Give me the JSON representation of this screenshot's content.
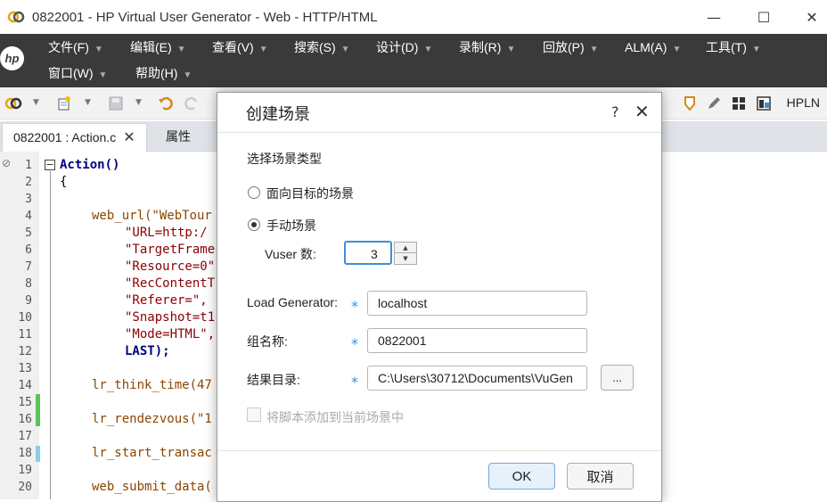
{
  "window": {
    "title": "0822001 - HP Virtual User Generator - Web - HTTP/HTML",
    "minimize": "—",
    "maximize": "☐",
    "close": "✕"
  },
  "menu": {
    "row1": [
      "文件(F)",
      "编辑(E)",
      "查看(V)",
      "搜索(S)",
      "设计(D)",
      "录制(R)",
      "回放(P)",
      "ALM(A)",
      "工具(T)"
    ],
    "row2": [
      "窗口(W)",
      "帮助(H)"
    ],
    "logo": "hp"
  },
  "toolbar": {
    "right_label": "HPLN"
  },
  "tabs": {
    "active": "0822001 : Action.c",
    "close": "✕",
    "other": "属性"
  },
  "editor": {
    "lines": [
      {
        "n": "1",
        "text": "Action()"
      },
      {
        "n": "2",
        "text": "{"
      },
      {
        "n": "3",
        "text": ""
      },
      {
        "n": "4",
        "text": "web_url(\"WebTour"
      },
      {
        "n": "5",
        "text": "\"URL=http:/"
      },
      {
        "n": "6",
        "text": "\"TargetFrame"
      },
      {
        "n": "7",
        "text": "\"Resource=0\""
      },
      {
        "n": "8",
        "text": "\"RecContentT"
      },
      {
        "n": "9",
        "text": "\"Referer=\","
      },
      {
        "n": "10",
        "text": "\"Snapshot=t1"
      },
      {
        "n": "11",
        "text": "\"Mode=HTML\","
      },
      {
        "n": "12",
        "text": "LAST);"
      },
      {
        "n": "13",
        "text": ""
      },
      {
        "n": "14",
        "text": "lr_think_time(47"
      },
      {
        "n": "15",
        "text": ""
      },
      {
        "n": "16",
        "text": "lr_rendezvous(\"1"
      },
      {
        "n": "17",
        "text": ""
      },
      {
        "n": "18",
        "text": "lr_start_transac"
      },
      {
        "n": "19",
        "text": ""
      },
      {
        "n": "20",
        "text": "web_submit_data("
      }
    ]
  },
  "dialog": {
    "title": "创建场景",
    "help": "?",
    "close": "✕",
    "section_label": "选择场景类型",
    "radio_goal": "面向目标的场景",
    "radio_manual": "手动场景",
    "vuser_label": "Vuser 数:",
    "vuser_value": "3",
    "spin_up": "▲",
    "spin_down": "▼",
    "load_generator_label": "Load Generator:",
    "load_generator_value": "localhost",
    "group_label": "组名称:",
    "group_value": "0822001",
    "result_label": "结果目录:",
    "result_value": "C:\\Users\\30712\\Documents\\VuGen",
    "browse": "...",
    "required": "*",
    "checkbox_label": "将脚本添加到当前场景中",
    "ok": "OK",
    "cancel": "取消"
  }
}
